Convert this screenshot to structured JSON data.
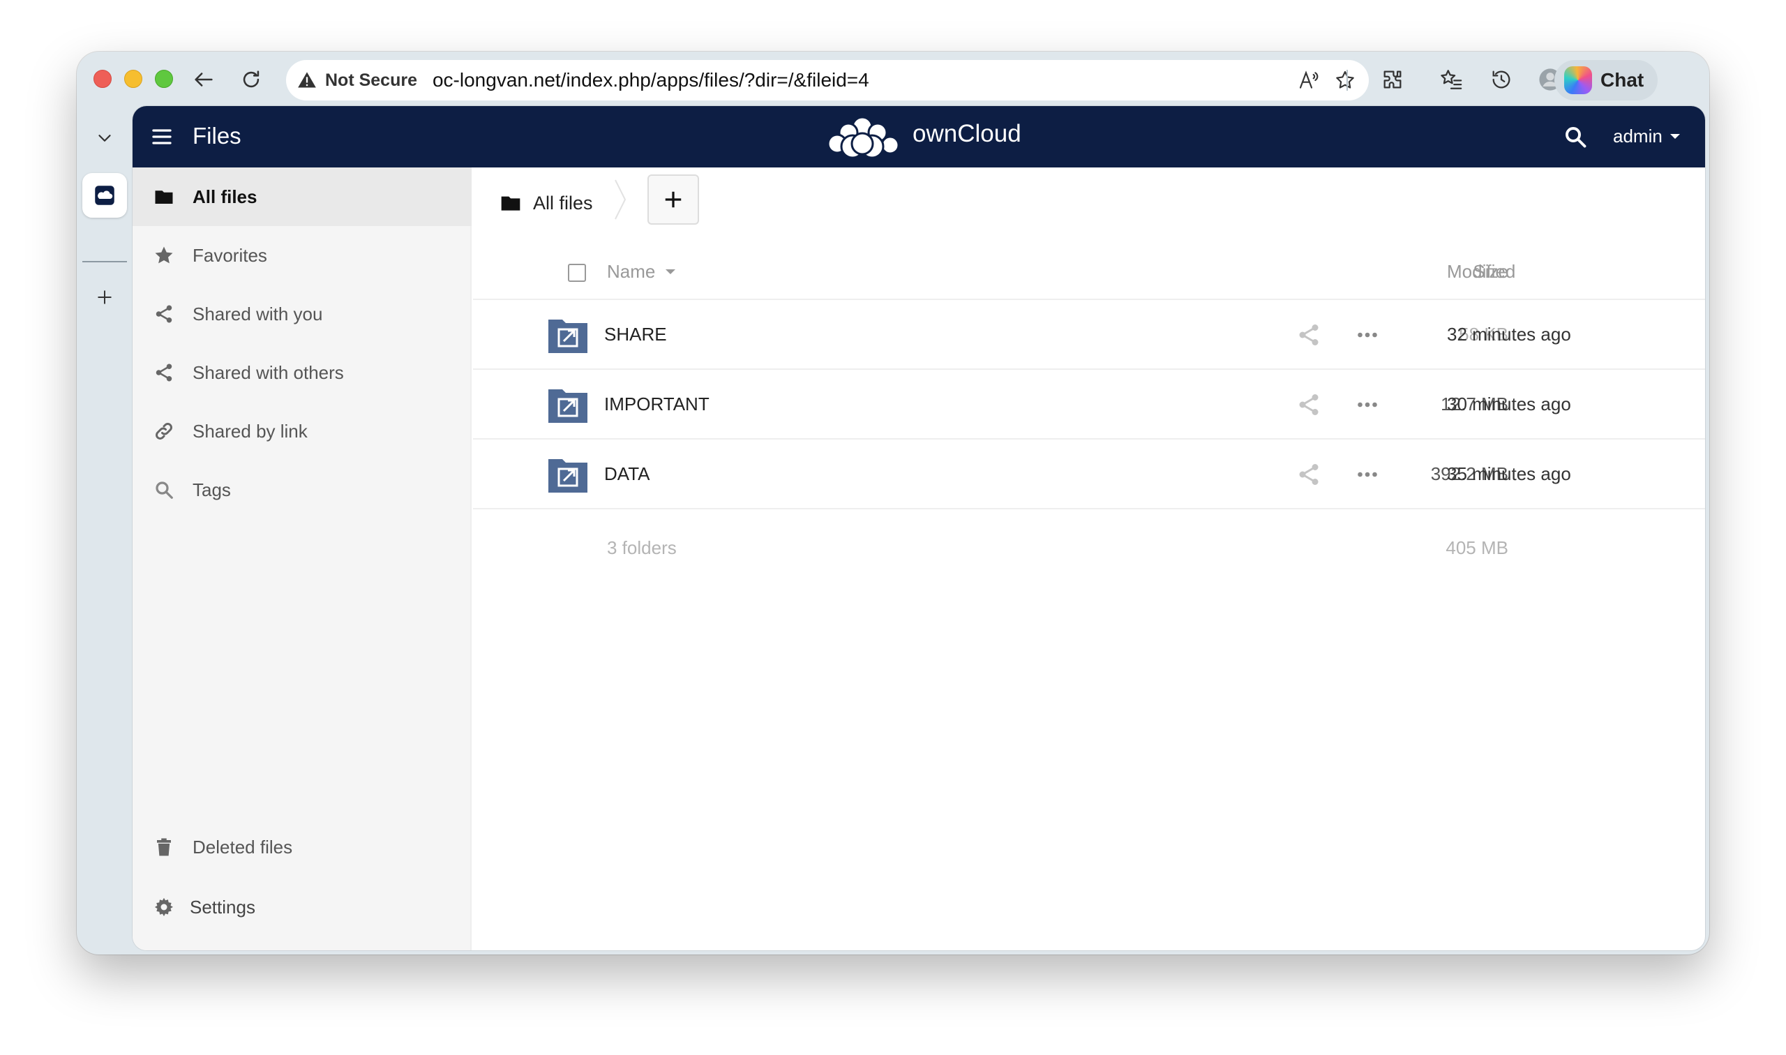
{
  "browser": {
    "security_label": "Not Secure",
    "url": "oc-longvan.net/index.php/apps/files/?dir=/&fileid=4",
    "chat_label": "Chat"
  },
  "app": {
    "title": "Files",
    "brand": "ownCloud",
    "user": "admin",
    "header_color": "#0d1e44",
    "folder_color": "#4f6a95"
  },
  "sidebar": {
    "items": [
      {
        "label": "All files",
        "icon": "folder-icon"
      },
      {
        "label": "Favorites",
        "icon": "star-icon"
      },
      {
        "label": "Shared with you",
        "icon": "share-icon"
      },
      {
        "label": "Shared with others",
        "icon": "share-icon"
      },
      {
        "label": "Shared by link",
        "icon": "link-icon"
      },
      {
        "label": "Tags",
        "icon": "search-icon"
      }
    ],
    "deleted_label": "Deleted files",
    "settings_label": "Settings"
  },
  "breadcrumb": {
    "label": "All files",
    "new_label": "+"
  },
  "table": {
    "columns": {
      "name": "Name",
      "size": "Size",
      "modified": "Modified"
    },
    "rows": [
      {
        "name": "SHARE",
        "size": "58 KB",
        "modified": "32 minutes ago"
      },
      {
        "name": "IMPORTANT",
        "size": "12.7 MB",
        "modified": "30 minutes ago"
      },
      {
        "name": "DATA",
        "size": "392.2 MB",
        "modified": "35 minutes ago"
      }
    ],
    "summary": {
      "count": "3 folders",
      "size": "405 MB"
    }
  }
}
